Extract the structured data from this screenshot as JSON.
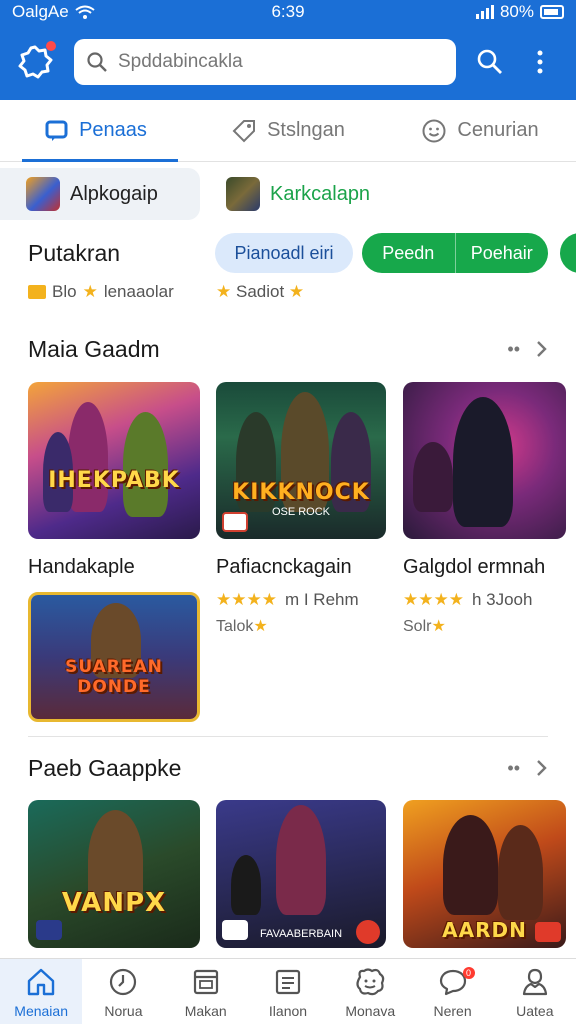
{
  "status_bar": {
    "carrier": "OalgAe",
    "time": "6:39",
    "battery": "80%"
  },
  "header": {
    "search_placeholder": "Spddabincakla",
    "logo_icon": "gear-logo-icon"
  },
  "tabs": [
    {
      "label": "Penaas",
      "icon": "chat-icon",
      "active": true
    },
    {
      "label": "Stslngan",
      "icon": "tag-icon",
      "active": false
    },
    {
      "label": "Cenurian",
      "icon": "smile-icon",
      "active": false
    }
  ],
  "subnav": [
    {
      "label": "Alpkogaip",
      "selected": true
    },
    {
      "label": "Karkcalapn",
      "selected": false
    }
  ],
  "filter": {
    "title": "Putakran",
    "left_sub": "Blo",
    "left_sub2": "lenaaolar",
    "right_sub": "Sadiot",
    "pill_light": "Pianoadl eiri",
    "pill_green_1": "Peedn",
    "pill_green_2": "Poehair"
  },
  "section1": {
    "title": "Maia Gaadm",
    "games": [
      {
        "banner": "IHEKPABK",
        "name": "Handakaple"
      },
      {
        "banner": "KIKKNOCK",
        "banner_sub": "OSE ROCK",
        "name": "Pafiacnckagain",
        "rating_text": "m I Rehm",
        "sub": "Talok"
      },
      {
        "banner": "",
        "name": "Galgdol ermnah",
        "rating_text": "h 3Jooh",
        "sub": "Solr"
      },
      {
        "banner": "SUAREAN DONDE",
        "name": ""
      }
    ]
  },
  "section2": {
    "title": "Paeb Gaappke",
    "games": [
      {
        "banner": "VANPX",
        "name": ""
      },
      {
        "banner": "FAVAABERBAIN",
        "name": ""
      },
      {
        "banner": "AARDN",
        "name": ""
      }
    ]
  },
  "bottom_nav": [
    {
      "label": "Menaian",
      "icon": "home-icon",
      "active": true
    },
    {
      "label": "Norua",
      "icon": "clock-icon",
      "active": false
    },
    {
      "label": "Makan",
      "icon": "calendar-icon",
      "active": false
    },
    {
      "label": "Ilanon",
      "icon": "list-icon",
      "active": false
    },
    {
      "label": "Monava",
      "icon": "face-icon",
      "active": false
    },
    {
      "label": "Neren",
      "icon": "message-icon",
      "active": false,
      "badge": "0"
    },
    {
      "label": "Uatea",
      "icon": "profile-icon",
      "active": false
    }
  ],
  "colors": {
    "brand": "#1b6fd6",
    "green": "#17a84b",
    "star": "#f3b21d"
  }
}
